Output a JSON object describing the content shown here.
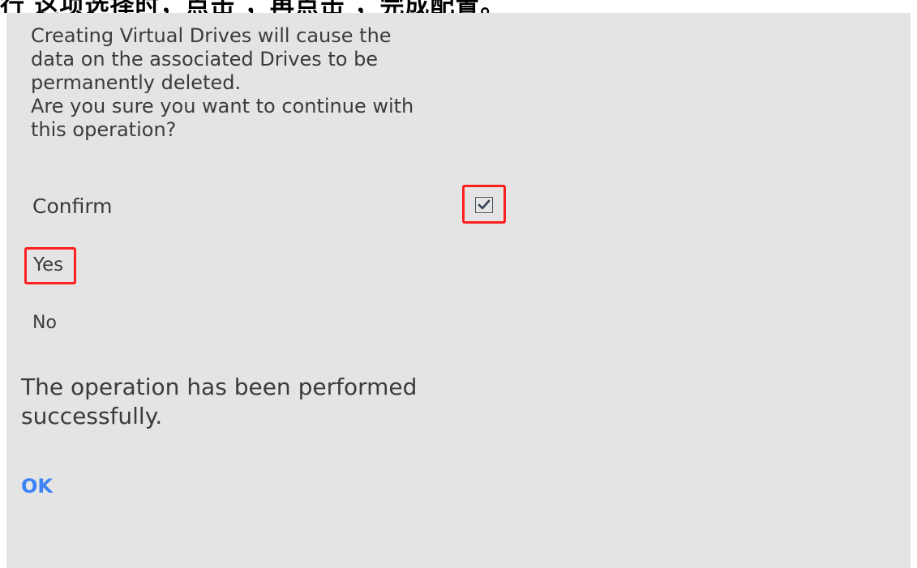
{
  "top_strip": {
    "text": "行          这项选择时，点击        ，再点击        ，完成配置。"
  },
  "dialog": {
    "warning_text": "Creating Virtual Drives will cause the\ndata on the associated Drives to be\npermanently deleted.\nAre you sure you want to continue with\nthis operation?",
    "confirm_label": "Confirm",
    "confirm_checked": true,
    "yes_label": "Yes",
    "no_label": "No",
    "success_text": "The operation has been performed\nsuccessfully.",
    "ok_label": "OK"
  },
  "colors": {
    "dialog_bg": "#e4e4e4",
    "highlight": "#ff1f1f",
    "link": "#3b82f6",
    "text": "#3b3b3b"
  }
}
